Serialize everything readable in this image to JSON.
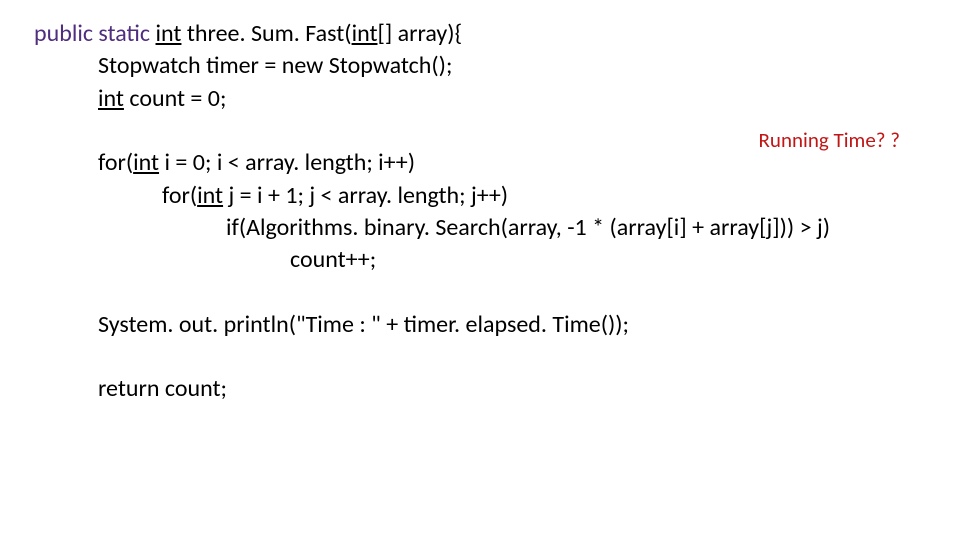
{
  "code": {
    "l1_kw": "public static",
    "l1_rest_a": " ",
    "l1_rest_b": "int",
    "l1_rest_c": " three. Sum. Fast(",
    "l1_rest_d": "int",
    "l1_rest_e": "[] array){",
    "l2": "Stopwatch timer = new Stopwatch();",
    "l3_a": "int",
    "l3_b": " count = 0;",
    "l4_a": "for(",
    "l4_b": "int",
    "l4_c": " i = 0; i < array. length; i++)",
    "l5_a": "for(",
    "l5_b": "int",
    "l5_c": " j = i + 1; j < array. length; j++)",
    "l6": "if(Algorithms. binary. Search(array, -1 * (array[i] + array[j])) > j)",
    "l7": "count++;",
    "l8": "System. out. println(\"Time : \" + timer. elapsed. Time());",
    "l9": "return count;"
  },
  "annotation": "Running Time? ?"
}
